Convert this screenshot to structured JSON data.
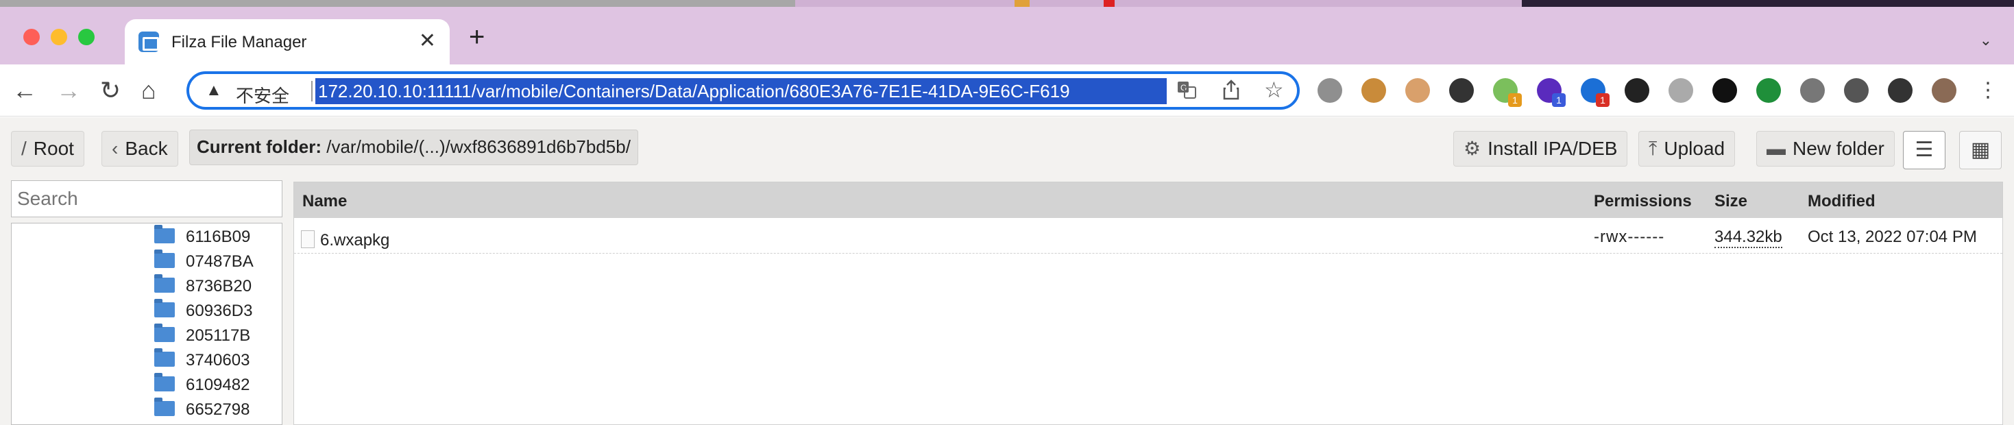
{
  "browser": {
    "tab_title": "Filza File Manager",
    "tab_close": "✕",
    "new_tab": "+",
    "tab_menu": "⌄",
    "nav": {
      "back": "←",
      "forward": "→",
      "reload": "↻",
      "home": "⌂"
    },
    "omnibox": {
      "warning_icon": "▲",
      "security_label": "不安全",
      "url": "172.20.10.10:11111/var/mobile/Containers/Data/Application/680E3A76-7E1E-41DA-9E6C-F619"
    },
    "extensions": [
      {
        "name": "download-icon",
        "color": "#8f8f8f",
        "badge": ""
      },
      {
        "name": "cookie-icon",
        "color": "#c98b3a",
        "badge": ""
      },
      {
        "name": "face-icon",
        "color": "#d9a06b",
        "badge": ""
      },
      {
        "name": "spy-icon",
        "color": "#333333",
        "badge": ""
      },
      {
        "name": "record-icon",
        "color": "#7bbf5c",
        "badge": "1",
        "badge_color": "#e59a1c"
      },
      {
        "name": "cube-icon",
        "color": "#5a2bbd",
        "badge": "1",
        "badge_color": "#3b5bdb"
      },
      {
        "name": "globe-icon",
        "color": "#1b6fd6",
        "badge": "1",
        "badge_color": "#d93025"
      },
      {
        "name": "hacker-icon",
        "color": "#222222",
        "badge": ""
      },
      {
        "name": "gitzip-icon",
        "color": "#aaaaaa",
        "badge": ""
      },
      {
        "name": "block-icon",
        "color": "#111111",
        "badge": ""
      },
      {
        "name": "leaf-icon",
        "color": "#1f8f3a",
        "badge": ""
      },
      {
        "name": "js-icon",
        "color": "#777777",
        "badge": ""
      },
      {
        "name": "puzzle-icon",
        "color": "#555555",
        "badge": ""
      },
      {
        "name": "sidepanel-icon",
        "color": "#333333",
        "badge": ""
      },
      {
        "name": "avatar",
        "color": "#8a6a55",
        "badge": ""
      },
      {
        "name": "more-icon",
        "color": "#444444",
        "badge": ""
      }
    ]
  },
  "filza": {
    "root_label": "Root",
    "back_label": "Back",
    "current_folder_label": "Current folder:",
    "current_folder_path": "/var/mobile/(...)/wxf8636891d6b7bd5b/",
    "install_label": "Install IPA/DEB",
    "upload_label": "Upload",
    "new_folder_label": "New folder",
    "search_placeholder": "Search",
    "tree": [
      "6116B09",
      "07487BA",
      "8736B20",
      "60936D3",
      "205117B",
      "3740603",
      "6109482",
      "6652798"
    ],
    "columns": {
      "name": "Name",
      "permissions": "Permissions",
      "size": "Size",
      "modified": "Modified"
    },
    "files": [
      {
        "name": "6.wxapkg",
        "permissions": "-rwx------",
        "size": "344.32kb",
        "modified": "Oct 13, 2022 07:04 PM"
      }
    ]
  }
}
